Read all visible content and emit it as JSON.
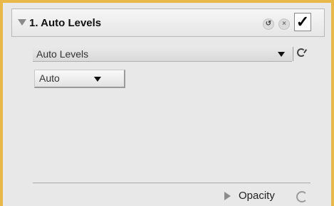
{
  "panel": {
    "title": "1. Auto Levels",
    "undo_icon": "undo-icon",
    "reset_icon": "reset-icon",
    "enable_checked": true,
    "enable_glyph": "✓",
    "undo_glyph": "↺",
    "reset_glyph": "×",
    "accent_border": "#e8b84a"
  },
  "method": {
    "selected": "Auto Levels"
  },
  "mode": {
    "selected": "Auto"
  },
  "opacity": {
    "label": "Opacity"
  }
}
